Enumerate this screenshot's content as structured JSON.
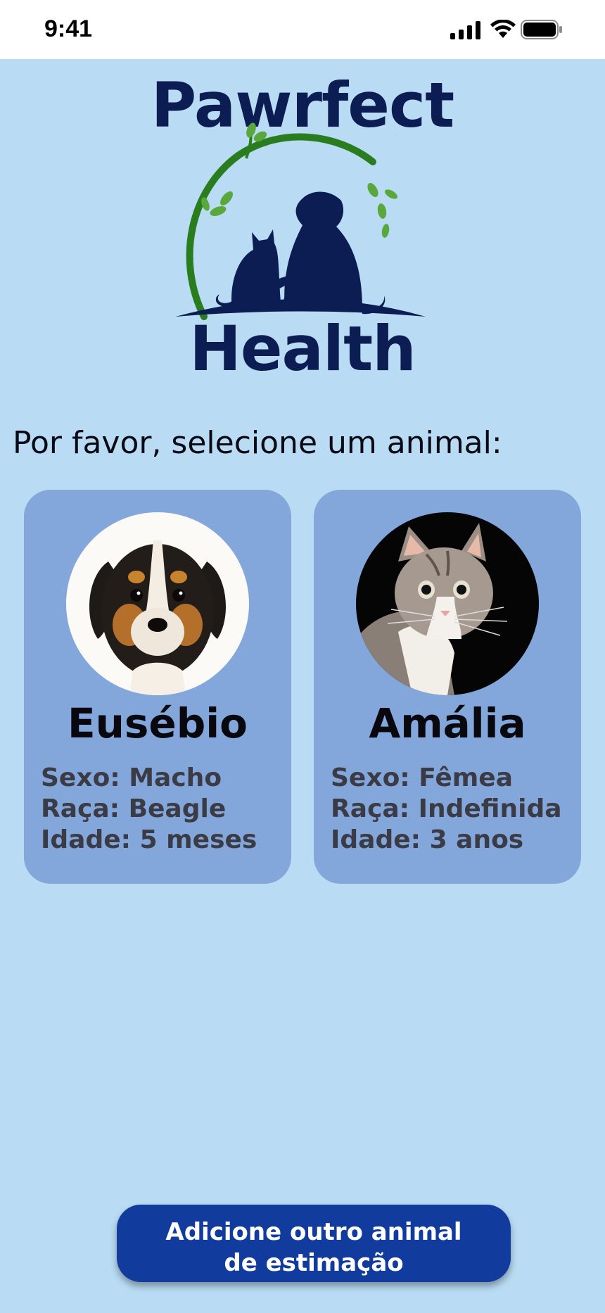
{
  "status_bar": {
    "time": "9:41"
  },
  "logo": {
    "title": "Pawrfect",
    "subtitle": "Health"
  },
  "prompt": "Por favor, selecione um animal:",
  "pets": [
    {
      "name": "Eusébio",
      "sex": "Sexo: Macho",
      "breed": "Raça:  Beagle",
      "age": "Idade: 5 meses",
      "photo_icon": "puppy-photo"
    },
    {
      "name": "Amália",
      "sex": "Sexo: Fêmea",
      "breed": "Raça:  Indefinida",
      "age": "Idade: 3 anos",
      "photo_icon": "cat-photo"
    }
  ],
  "add_button": {
    "line1": "Adicione outro animal",
    "line2": "de estimação"
  },
  "colors": {
    "background": "#b9dcf4",
    "card": "#84a7db",
    "brand_navy": "#0c1d54",
    "brand_green": "#2a7d1f",
    "button": "#123b9e"
  }
}
